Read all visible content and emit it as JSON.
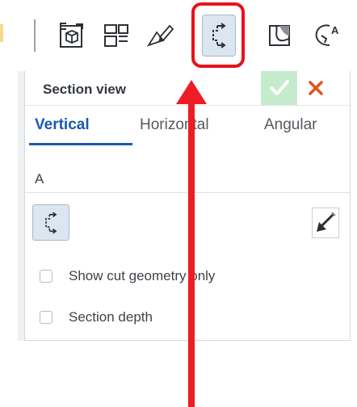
{
  "toolbar": {
    "tools": [
      {
        "name": "derived-part-icon"
      },
      {
        "name": "drawing-view-icon"
      },
      {
        "name": "sketch-pencil-icon"
      },
      {
        "name": "section-view-icon",
        "active": true
      },
      {
        "name": "broken-out-section-icon"
      },
      {
        "name": "detail-view-icon"
      }
    ]
  },
  "panel": {
    "title": "Section view",
    "accept_icon": "checkmark-icon",
    "cancel_icon": "close-x-icon",
    "tabs": [
      {
        "label": "Vertical",
        "active": true
      },
      {
        "label": "Horizontal",
        "active": false
      },
      {
        "label": "Angular",
        "active": false
      }
    ],
    "section_name_value": "A",
    "checkboxes": [
      {
        "label": "Show cut geometry only",
        "checked": false
      },
      {
        "label": "Section depth",
        "checked": false
      }
    ]
  },
  "annotation": {
    "highlight_color": "#e8121a",
    "arrow_color": "#ee1c24"
  }
}
